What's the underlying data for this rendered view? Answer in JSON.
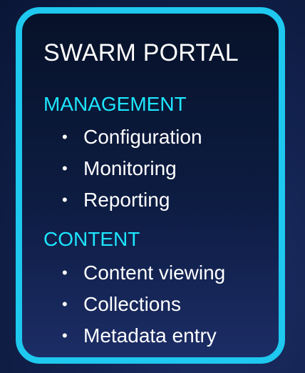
{
  "portal": {
    "title": "SWARM PORTAL"
  },
  "sections": [
    {
      "heading": "MANAGEMENT",
      "items": [
        "Configuration",
        "Monitoring",
        "Reporting"
      ]
    },
    {
      "heading": "CONTENT",
      "items": [
        "Content viewing",
        "Collections",
        "Metadata entry"
      ]
    }
  ],
  "bullet_glyph": "•",
  "colors": {
    "border": "#1ec8ef",
    "heading": "#1ee6ff",
    "text": "#ffffff",
    "background": "#0d1c42"
  }
}
